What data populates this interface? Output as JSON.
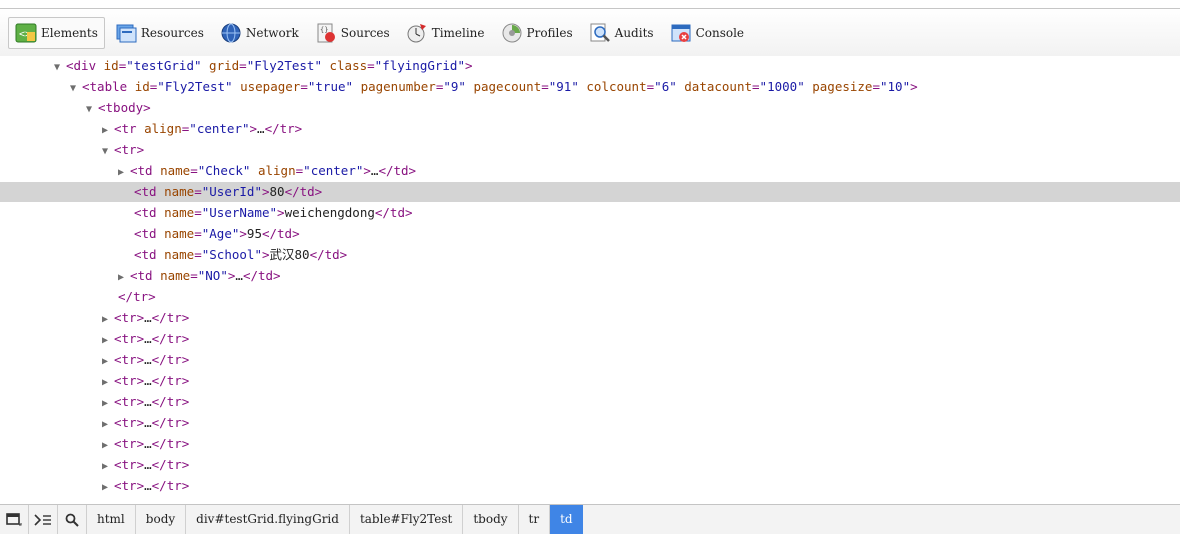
{
  "toolbar": {
    "tabs": [
      {
        "label": "Elements",
        "icon": "elements-icon"
      },
      {
        "label": "Resources",
        "icon": "resources-icon"
      },
      {
        "label": "Network",
        "icon": "network-icon"
      },
      {
        "label": "Sources",
        "icon": "sources-icon"
      },
      {
        "label": "Timeline",
        "icon": "timeline-icon"
      },
      {
        "label": "Profiles",
        "icon": "profiles-icon"
      },
      {
        "label": "Audits",
        "icon": "audits-icon"
      },
      {
        "label": "Console",
        "icon": "console-icon"
      }
    ],
    "active_tab": "Elements"
  },
  "dom_tree": {
    "div": {
      "tag": "div",
      "id": "testGrid",
      "grid": "Fly2Test",
      "class": "flyingGrid"
    },
    "table": {
      "tag": "table",
      "id": "Fly2Test",
      "usepager": "true",
      "pagenumber": "9",
      "pagecount": "91",
      "colcount": "6",
      "datacount": "1000",
      "pagesize": "10"
    },
    "tbody": "tbody",
    "tr_header": {
      "attr": "align",
      "value": "center",
      "ellipsis": "…"
    },
    "tr_open": "tr",
    "td_check": {
      "name": "Check",
      "align": "center",
      "ellipsis": "…"
    },
    "td_userid": {
      "name": "UserId",
      "text": "80"
    },
    "td_username": {
      "name": "UserName",
      "text": "weichengdong"
    },
    "td_age": {
      "name": "Age",
      "text": "95"
    },
    "td_school": {
      "name": "School",
      "text": "武汉80"
    },
    "td_no": {
      "name": "NO",
      "ellipsis": "…"
    },
    "tr_close": "tr",
    "collapsed_rows": [
      "tr",
      "tr",
      "tr",
      "tr",
      "tr",
      "tr",
      "tr",
      "tr",
      "tr"
    ],
    "selected_row": "td name=UserId"
  },
  "breadcrumbs": {
    "items": [
      "html",
      "body",
      "div#testGrid.flyingGrid",
      "table#Fly2Test",
      "tbody",
      "tr",
      "td"
    ],
    "active": "td"
  },
  "colors": {
    "tag": "#881280",
    "attr_name": "#994500",
    "attr_value": "#1a1aa6",
    "selection": "#d4d4d4",
    "active_crumb": "#3f85e6"
  }
}
